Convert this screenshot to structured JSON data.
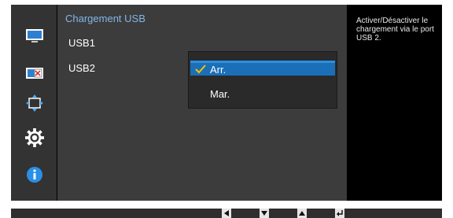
{
  "sidebar": {
    "icons": [
      "picture-icon",
      "color-icon",
      "position-icon",
      "system-icon",
      "information-icon"
    ],
    "active_index": 3
  },
  "menu": {
    "title": "Chargement USB",
    "items": [
      {
        "label": "USB1"
      },
      {
        "label": "USB2",
        "selected": true
      }
    ]
  },
  "dropdown": {
    "options": [
      {
        "label": "Arr.",
        "selected": true
      },
      {
        "label": "Mar.",
        "selected": false
      }
    ]
  },
  "help": {
    "text": "Activer/Désactiver le chargement via le port USB 2."
  },
  "footer": {
    "keys": [
      "left-arrow-icon",
      "down-arrow-icon",
      "up-arrow-icon",
      "enter-icon"
    ]
  },
  "colors": {
    "title": "#82b6e8",
    "highlight": "#1a6fb8",
    "check": "#f2c200",
    "info": "#2a8fe8"
  }
}
